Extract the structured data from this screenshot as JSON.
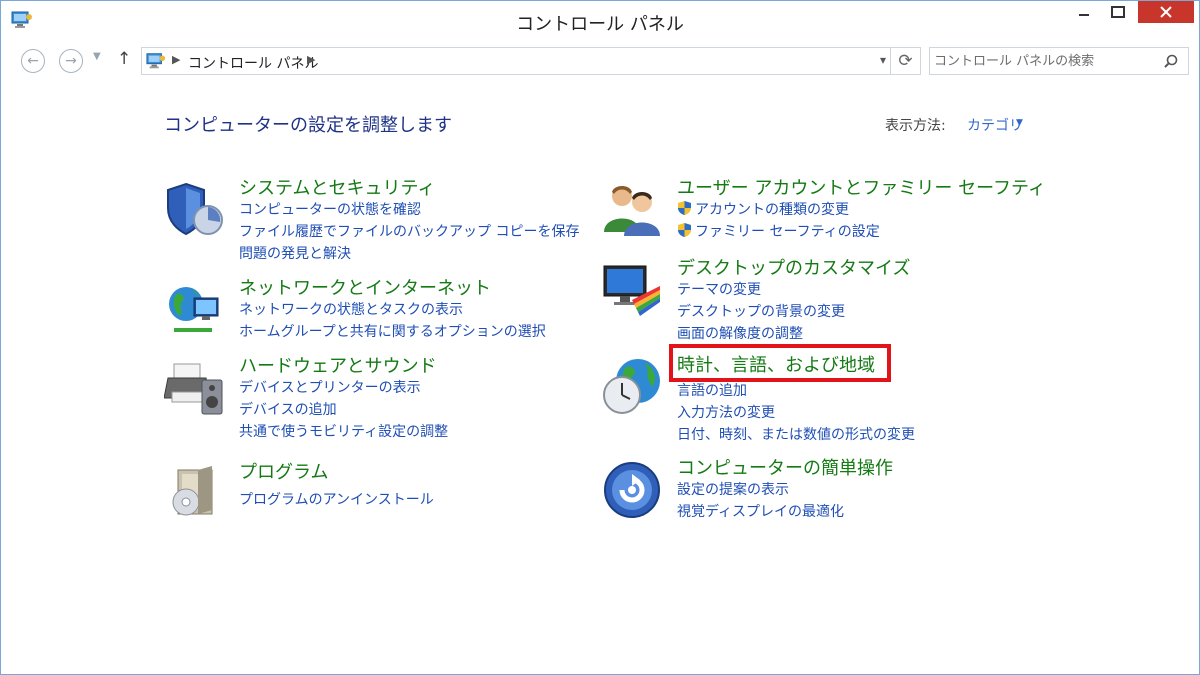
{
  "window": {
    "title": "コントロール パネル"
  },
  "nav": {
    "back_label": "←",
    "forward_label": "→",
    "up_label": "↑",
    "breadcrumb": "コントロール パネル",
    "search_placeholder": "コントロール パネルの検索"
  },
  "main": {
    "heading": "コンピューターの設定を調整します",
    "view_by_label": "表示方法:",
    "view_by_value": "カテゴリ"
  },
  "categories": [
    {
      "title": "システムとセキュリティ",
      "icon": "security-shield-icon",
      "links": [
        "コンピューターの状態を確認",
        "ファイル履歴でファイルのバックアップ コピーを保存",
        "問題の発見と解決"
      ]
    },
    {
      "title": "ネットワークとインターネット",
      "icon": "network-globe-icon",
      "links": [
        "ネットワークの状態とタスクの表示",
        "ホームグループと共有に関するオプションの選択"
      ]
    },
    {
      "title": "ハードウェアとサウンド",
      "icon": "printer-speaker-icon",
      "links": [
        "デバイスとプリンターの表示",
        "デバイスの追加",
        "共通で使うモビリティ設定の調整"
      ]
    },
    {
      "title": "プログラム",
      "icon": "programs-box-icon",
      "links": [
        "プログラムのアンインストール"
      ]
    },
    {
      "title": "ユーザー アカウントとファミリー セーフティ",
      "icon": "users-icon",
      "links": [
        "アカウントの種類の変更",
        "ファミリー セーフティの設定"
      ]
    },
    {
      "title": "デスクトップのカスタマイズ",
      "icon": "desktop-color-icon",
      "links": [
        "テーマの変更",
        "デスクトップの背景の変更",
        "画面の解像度の調整"
      ]
    },
    {
      "title": "時計、言語、および地域",
      "icon": "clock-globe-icon",
      "links": [
        "言語の追加",
        "入力方法の変更",
        "日付、時刻、または数値の形式の変更"
      ]
    },
    {
      "title": "コンピューターの簡単操作",
      "icon": "ease-of-access-icon",
      "links": [
        "設定の提案の表示",
        "視覚ディスプレイの最適化"
      ]
    }
  ],
  "colors": {
    "category_title": "#147a14",
    "link": "#1f4eb4",
    "heading": "#1e3287",
    "highlight": "#e3131a",
    "close_button": "#c7352b"
  }
}
